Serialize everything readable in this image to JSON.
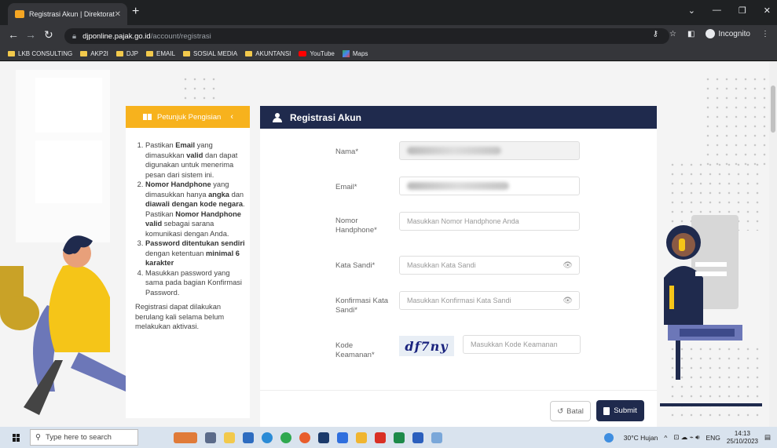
{
  "browser": {
    "tab_title": "Registrasi Akun | Direktorat Jend",
    "url_host": "djponline.pajak.go.id",
    "url_path": "/account/registrasi",
    "mode_label": "Incognito"
  },
  "bookmarks": [
    {
      "label": "LKB CONSULTING",
      "type": "folder"
    },
    {
      "label": "AKP2I",
      "type": "folder"
    },
    {
      "label": "DJP",
      "type": "folder"
    },
    {
      "label": "EMAIL",
      "type": "folder"
    },
    {
      "label": "SOSIAL MEDIA",
      "type": "folder"
    },
    {
      "label": "AKUNTANSI",
      "type": "folder"
    },
    {
      "label": "YouTube",
      "type": "youtube"
    },
    {
      "label": "Maps",
      "type": "maps"
    }
  ],
  "sidebar": {
    "title": "Petunjuk Pengisian",
    "note": "Registrasi dapat dilakukan berulang kali selama belum melakukan aktivasi."
  },
  "form": {
    "title": "Registrasi Akun",
    "nama_label": "Nama*",
    "email_label": "Email*",
    "phone_label": "Nomor Handphone*",
    "phone_placeholder": "Masukkan Nomor Handphone Anda",
    "pass_label": "Kata Sandi*",
    "pass_placeholder": "Masukkan Kata Sandi",
    "confirm_label": "Konfirmasi Kata Sandi*",
    "confirm_placeholder": "Masukkan Konfirmasi Kata Sandi",
    "code_label": "Kode Keamanan*",
    "code_placeholder": "Masukkan Kode Keamanan",
    "captcha_text": "df7ny",
    "cancel_label": "Batal",
    "submit_label": "Submit"
  },
  "taskbar": {
    "search_placeholder": "Type here to search",
    "weather": "30°C Hujan",
    "lang": "ENG",
    "time": "14:13",
    "date": "25/10/2023"
  },
  "colors": {
    "accent_orange": "#f7b21d",
    "accent_navy": "#1f2a4d"
  }
}
